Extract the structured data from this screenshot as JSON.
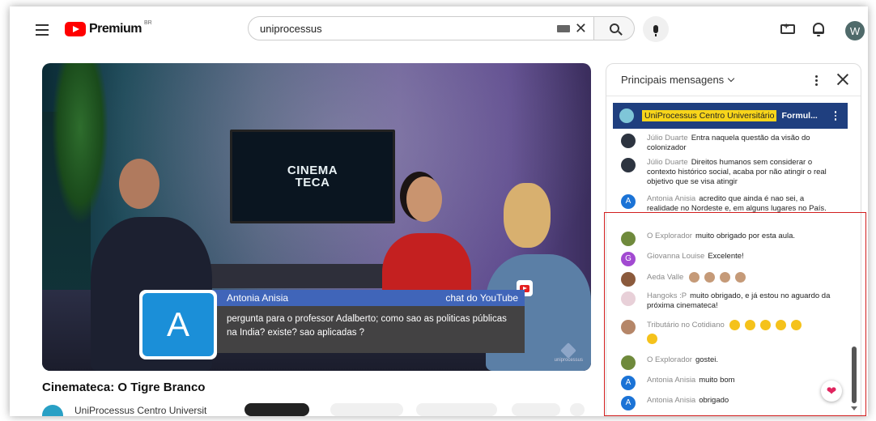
{
  "header": {
    "logo_text": "Premium",
    "logo_region": "BR",
    "search_value": "uniprocessus",
    "avatar_letter": "W"
  },
  "video": {
    "screen_logo_top": "CINEMA",
    "screen_logo_bottom": "TECA",
    "overlay": {
      "avatar_letter": "A",
      "author": "Antonia Anisia",
      "source": "chat do YouTube",
      "message": "pergunta para o professor Adalberto; como sao as politicas públicas na India? existe? sao aplicadas ?"
    },
    "watermark": "uniprocessus",
    "title": "Cinematecа: O Tigre Branco",
    "channel_partial": "UniProcessus Centro Universit"
  },
  "chat": {
    "title": "Principais mensagens",
    "pinned": {
      "name": "UniProcessus Centro Universitário",
      "text": "Formul..."
    },
    "messages": [
      {
        "author": "Júlio Duarte",
        "text": "Entra naquela questão da visão do colonizador",
        "avatar": "",
        "color": "#2d3440"
      },
      {
        "author": "Júlio Duarte",
        "text": "Direitos humanos sem considerar o contexto histórico social, acaba por não atingir o real objetivo que se visa atingir",
        "avatar": "",
        "color": "#2d3440"
      },
      {
        "author": "Antonia Anisia",
        "text": "acredito que ainda é nao sei, a realidade no Nordeste e, em alguns lugares no País.",
        "avatar": "A",
        "color": "#1b73d6"
      },
      {
        "author": "O Explorador",
        "text": "muito obrigado por esta aula.",
        "avatar": "",
        "color": "#6f8a3c"
      },
      {
        "author": "Giovanna Louise",
        "text": "Excelente!",
        "avatar": "G",
        "color": "#a24ad1"
      },
      {
        "author": "Aeda Valle",
        "text": "",
        "avatar": "",
        "color": "#8b5a3c"
      },
      {
        "author": "Hangoks :P",
        "text": "muito obrigado, e já estou no aguardo da próxima cinemateca!",
        "avatar": "",
        "color": "#e8d0d8"
      },
      {
        "author": "Tributário no Cotidiano",
        "text": "",
        "avatar": "",
        "color": "#b58668"
      },
      {
        "author": "O Explorador",
        "text": "gostei.",
        "avatar": "",
        "color": "#6f8a3c"
      },
      {
        "author": "Antonia Anisia",
        "text": "muito bom",
        "avatar": "A",
        "color": "#1b73d6"
      },
      {
        "author": "Antonia Anisia",
        "text": "obrigado",
        "avatar": "A",
        "color": "#1b73d6"
      }
    ]
  },
  "colors": {
    "accent_red": "#ff0000",
    "overlay_blue": "#4065b9",
    "pinned_bg": "#1f3f7f",
    "highlight": "#d21e1e",
    "heart": "#e0245e"
  }
}
